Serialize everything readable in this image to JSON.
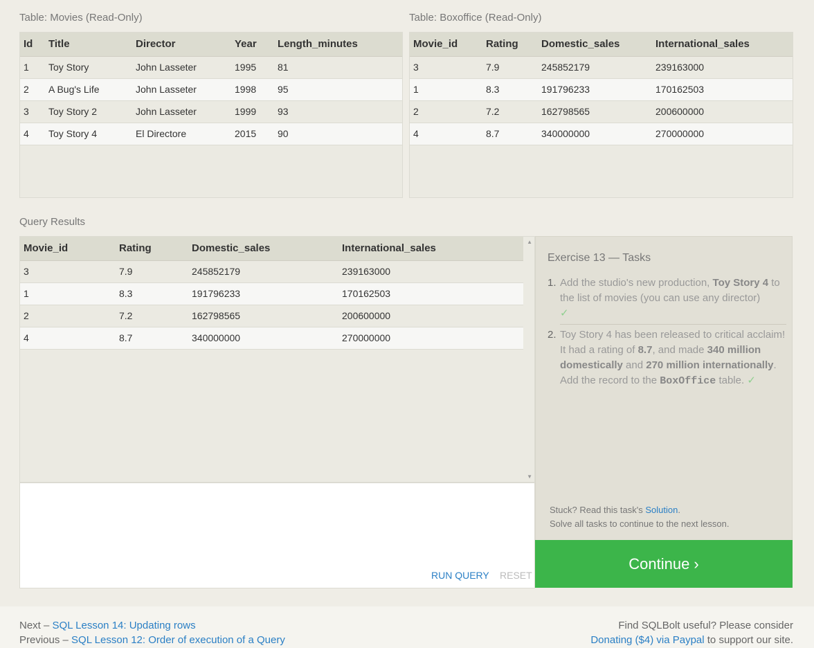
{
  "movies_table": {
    "caption": "Table: Movies (Read-Only)",
    "columns": [
      "Id",
      "Title",
      "Director",
      "Year",
      "Length_minutes"
    ],
    "rows": [
      [
        "1",
        "Toy Story",
        "John Lasseter",
        "1995",
        "81"
      ],
      [
        "2",
        "A Bug's Life",
        "John Lasseter",
        "1998",
        "95"
      ],
      [
        "3",
        "Toy Story 2",
        "John Lasseter",
        "1999",
        "93"
      ],
      [
        "4",
        "Toy Story 4",
        "El Directore",
        "2015",
        "90"
      ]
    ]
  },
  "boxoffice_table": {
    "caption": "Table: Boxoffice (Read-Only)",
    "columns": [
      "Movie_id",
      "Rating",
      "Domestic_sales",
      "International_sales"
    ],
    "rows": [
      [
        "3",
        "7.9",
        "245852179",
        "239163000"
      ],
      [
        "1",
        "8.3",
        "191796233",
        "170162503"
      ],
      [
        "2",
        "7.2",
        "162798565",
        "200600000"
      ],
      [
        "4",
        "8.7",
        "340000000",
        "270000000"
      ]
    ]
  },
  "query_results": {
    "caption": "Query Results",
    "columns": [
      "Movie_id",
      "Rating",
      "Domestic_sales",
      "International_sales"
    ],
    "rows": [
      [
        "3",
        "7.9",
        "245852179",
        "239163000"
      ],
      [
        "1",
        "8.3",
        "191796233",
        "170162503"
      ],
      [
        "2",
        "7.2",
        "162798565",
        "200600000"
      ],
      [
        "4",
        "8.7",
        "340000000",
        "270000000"
      ]
    ]
  },
  "editor": {
    "run_label": "RUN QUERY",
    "reset_label": "RESET"
  },
  "tasks": {
    "title": "Exercise 13 — Tasks",
    "task1": {
      "num": "1.",
      "pre": "Add the studio's new production, ",
      "bold": "Toy Story 4",
      "post": " to the list of movies (you can use any director)",
      "check": "✓"
    },
    "task2": {
      "num": "2.",
      "p1": "Toy Story 4 has been released to critical acclaim! It had a rating of ",
      "b1": "8.7",
      "p2": ", and made ",
      "b2": "340 million domestically",
      "p3": " and ",
      "b3": "270 million internationally",
      "p4": ". Add the record to the ",
      "code": "BoxOffice",
      "p5": " table. ",
      "check": "✓"
    },
    "stuck_pre": "Stuck? Read this task's ",
    "solution_link": "Solution",
    "stuck_post": ".",
    "solve_all": "Solve all tasks to continue to the next lesson."
  },
  "continue_label": "Continue ›",
  "footer": {
    "next_prefix": "Next – ",
    "next_link": "SQL Lesson 14: Updating rows",
    "prev_prefix": "Previous – ",
    "prev_link": "SQL Lesson 12: Order of execution of a Query",
    "find_useful": "Find SQLBolt useful? Please consider",
    "donate_link": "Donating ($4) via Paypal",
    "donate_post": " to support our site."
  }
}
